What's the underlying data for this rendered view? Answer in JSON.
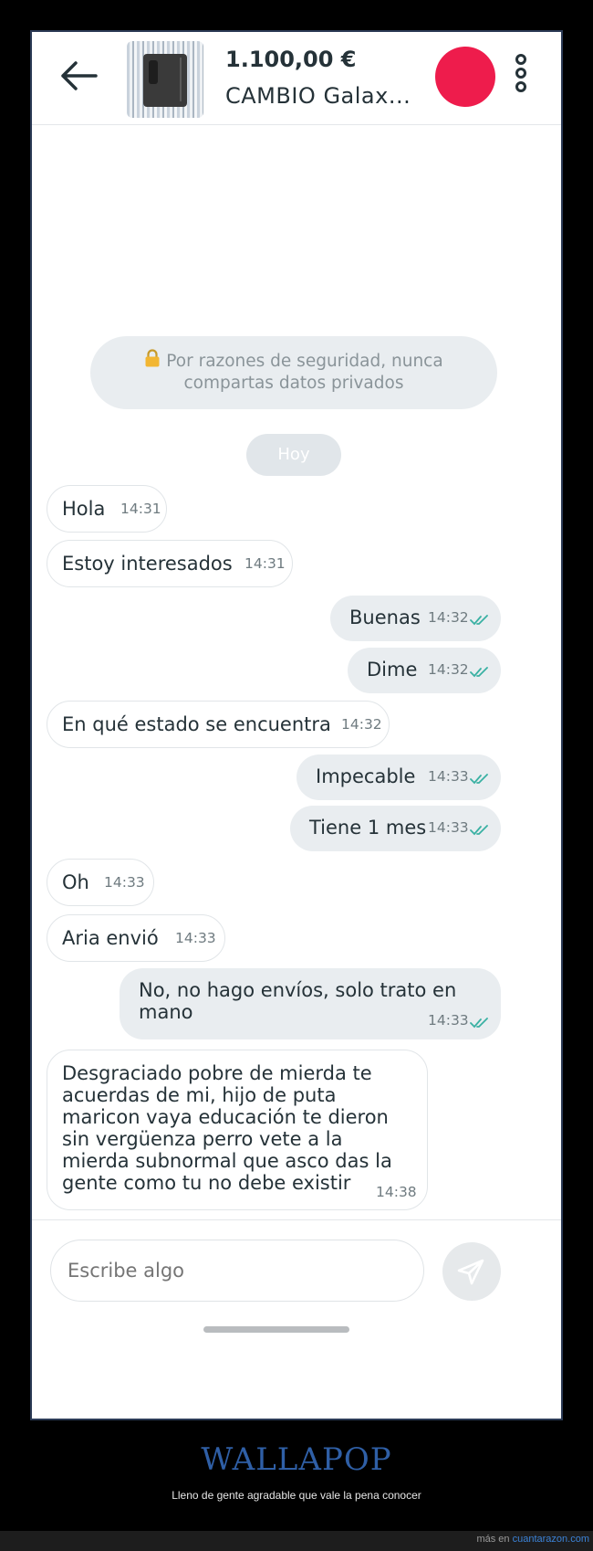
{
  "header": {
    "price": "1.100,00 €",
    "title": "CAMBIO Galax...",
    "avatar_color": "#ee1c4c"
  },
  "notice": {
    "text": "Por razones de seguridad, nunca compartas datos privados"
  },
  "date_chip": "Hoy",
  "messages": [
    {
      "direction": "in",
      "text": "Hola",
      "time": "14:31"
    },
    {
      "direction": "in",
      "text": "Estoy interesados",
      "time": "14:31"
    },
    {
      "direction": "out",
      "text": "Buenas",
      "time": "14:32",
      "read": true
    },
    {
      "direction": "out",
      "text": "Dime",
      "time": "14:32",
      "read": true
    },
    {
      "direction": "in",
      "text": "En qué estado se encuentra",
      "time": "14:32"
    },
    {
      "direction": "out",
      "text": "Impecable",
      "time": "14:33",
      "read": true
    },
    {
      "direction": "out",
      "text": "Tiene 1 mes",
      "time": "14:33",
      "read": true
    },
    {
      "direction": "in",
      "text": "Oh",
      "time": "14:33"
    },
    {
      "direction": "in",
      "text": "Aria envió",
      "time": "14:33"
    },
    {
      "direction": "out",
      "text": "No, no hago envíos, solo trato en mano",
      "time": "14:33",
      "read": true
    },
    {
      "direction": "in",
      "text": "Desgraciado pobre de mierda te acuerdas de mi, hijo de puta maricon vaya educación te dieron sin vergüenza perro vete a la mierda subnormal que asco das la gente como tu no debe existir",
      "time": "14:38"
    }
  ],
  "composer": {
    "placeholder": "Escribe algo"
  },
  "caption": {
    "title": "WALLAPOP",
    "subtitle": "Lleno de gente agradable que vale la pena conocer"
  },
  "footer": {
    "prefix": "más en",
    "site": "cuantarazon.com"
  },
  "colors": {
    "read_ticks": "#3ab1a3",
    "caption_title": "#2f5fa6"
  },
  "icons": [
    "back-arrow-icon",
    "more-vertical-icon",
    "lock-icon",
    "double-check-icon",
    "send-icon"
  ]
}
